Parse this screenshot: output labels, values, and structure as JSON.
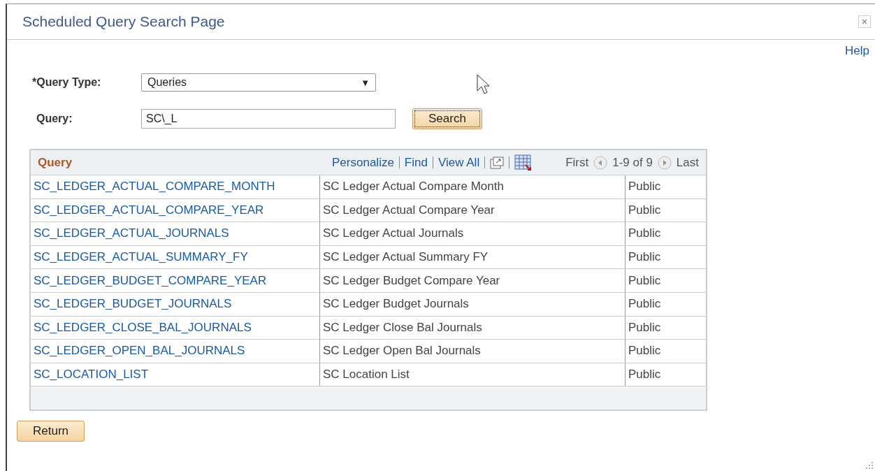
{
  "window": {
    "title": "Scheduled Query Search Page"
  },
  "help_link": "Help",
  "form": {
    "query_type": {
      "label": "*Query Type:",
      "value": "Queries",
      "arrow": "▼"
    },
    "query": {
      "label": "Query:",
      "value": "SC\\_L"
    },
    "search_button": "Search"
  },
  "grid": {
    "title": "Query",
    "toolbar": [
      "Personalize",
      "Find",
      "View All"
    ],
    "nav": {
      "first": "First",
      "range": "1-9 of 9",
      "last": "Last"
    },
    "rows": [
      [
        "SC_LEDGER_ACTUAL_COMPARE_MONTH",
        "SC Ledger Actual Compare Month",
        "Public"
      ],
      [
        "SC_LEDGER_ACTUAL_COMPARE_YEAR",
        "SC Ledger Actual Compare Year",
        "Public"
      ],
      [
        "SC_LEDGER_ACTUAL_JOURNALS",
        "SC Ledger Actual Journals",
        "Public"
      ],
      [
        "SC_LEDGER_ACTUAL_SUMMARY_FY",
        "SC Ledger Actual Summary FY",
        "Public"
      ],
      [
        "SC_LEDGER_BUDGET_COMPARE_YEAR",
        "SC Ledger Budget Compare Year",
        "Public"
      ],
      [
        "SC_LEDGER_BUDGET_JOURNALS",
        "SC Ledger Budget Journals",
        "Public"
      ],
      [
        "SC_LEDGER_CLOSE_BAL_JOURNALS",
        "SC Ledger Close Bal Journals",
        "Public"
      ],
      [
        "SC_LEDGER_OPEN_BAL_JOURNALS",
        "SC Ledger Open Bal Journals",
        "Public"
      ],
      [
        "SC_LOCATION_LIST",
        "SC Location List",
        "Public"
      ]
    ]
  },
  "return_button": "Return"
}
